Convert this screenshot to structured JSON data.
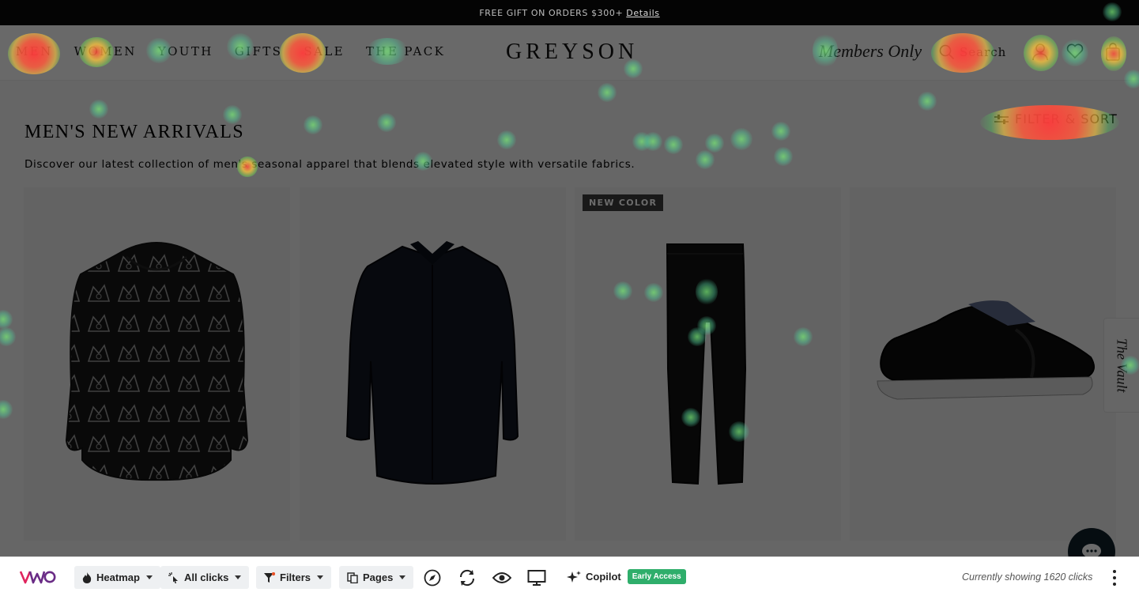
{
  "announcement": {
    "text": "FREE GIFT ON ORDERS $300+",
    "link": "Details"
  },
  "nav": [
    "MEN",
    "WOMEN",
    "YOUTH",
    "GIFTS",
    "SALE",
    "THE PACK"
  ],
  "brand": "GREYSON",
  "members_only": "Members Only",
  "search_label": "Search",
  "header_icons": [
    "user-icon",
    "heart-icon",
    "bag-icon"
  ],
  "collection": {
    "title": "MEN'S NEW ARRIVALS",
    "description": "Discover our latest collection of men's seasonal apparel that blends elevated style with versatile fabrics.",
    "filter_label": "FILTER & SORT"
  },
  "products": [
    {
      "image": "patterned-hoodie",
      "badge": ""
    },
    {
      "image": "black-dress-shirt",
      "badge": ""
    },
    {
      "image": "black-trousers",
      "badge": "NEW COLOR"
    },
    {
      "image": "black-sneaker",
      "badge": ""
    }
  ],
  "vault_tab": "The Vault",
  "toolbar": {
    "logo": "VWO",
    "heatmap": "Heatmap",
    "clicks": "All clicks",
    "filters": "Filters",
    "pages": "Pages",
    "copilot": "Copilot",
    "early_access": "Early Access",
    "status": "Currently showing 1620 clicks"
  },
  "colors": {
    "announce_bg": "#040404",
    "vwo_purple": "#6a2c86",
    "early_green": "#2fae6b"
  }
}
